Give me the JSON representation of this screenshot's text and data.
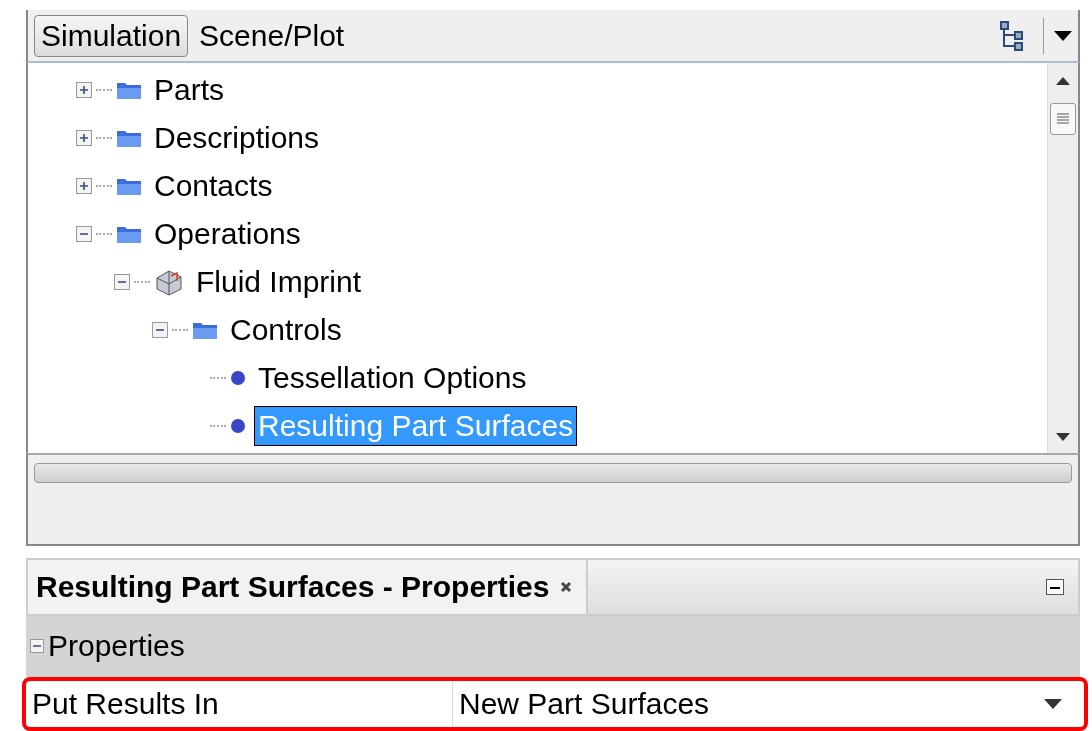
{
  "tabs": [
    {
      "label": "Simulation",
      "selected": true
    },
    {
      "label": "Scene/Plot",
      "selected": false
    }
  ],
  "tree": [
    {
      "label": "Parts",
      "kind": "folder",
      "expanded": false,
      "selected": false
    },
    {
      "label": "Descriptions",
      "kind": "folder",
      "expanded": false,
      "selected": false
    },
    {
      "label": "Contacts",
      "kind": "folder",
      "expanded": false,
      "selected": false
    },
    {
      "label": "Operations",
      "kind": "folder",
      "expanded": true,
      "selected": false,
      "children": [
        {
          "label": "Fluid Imprint",
          "kind": "operation",
          "expanded": true,
          "selected": false,
          "children": [
            {
              "label": "Controls",
              "kind": "folder",
              "expanded": true,
              "selected": false,
              "children": [
                {
                  "label": "Tessellation Options",
                  "kind": "leaf",
                  "selected": false
                },
                {
                  "label": "Resulting Part Surfaces",
                  "kind": "leaf",
                  "selected": true
                }
              ]
            }
          ]
        }
      ]
    }
  ],
  "properties_panel": {
    "title": "Resulting Part Surfaces - Properties",
    "section": {
      "label": "Properties",
      "expanded": true
    },
    "rows": [
      {
        "name": "Put Results In",
        "value": "New Part Surfaces",
        "highlighted": true
      }
    ]
  }
}
